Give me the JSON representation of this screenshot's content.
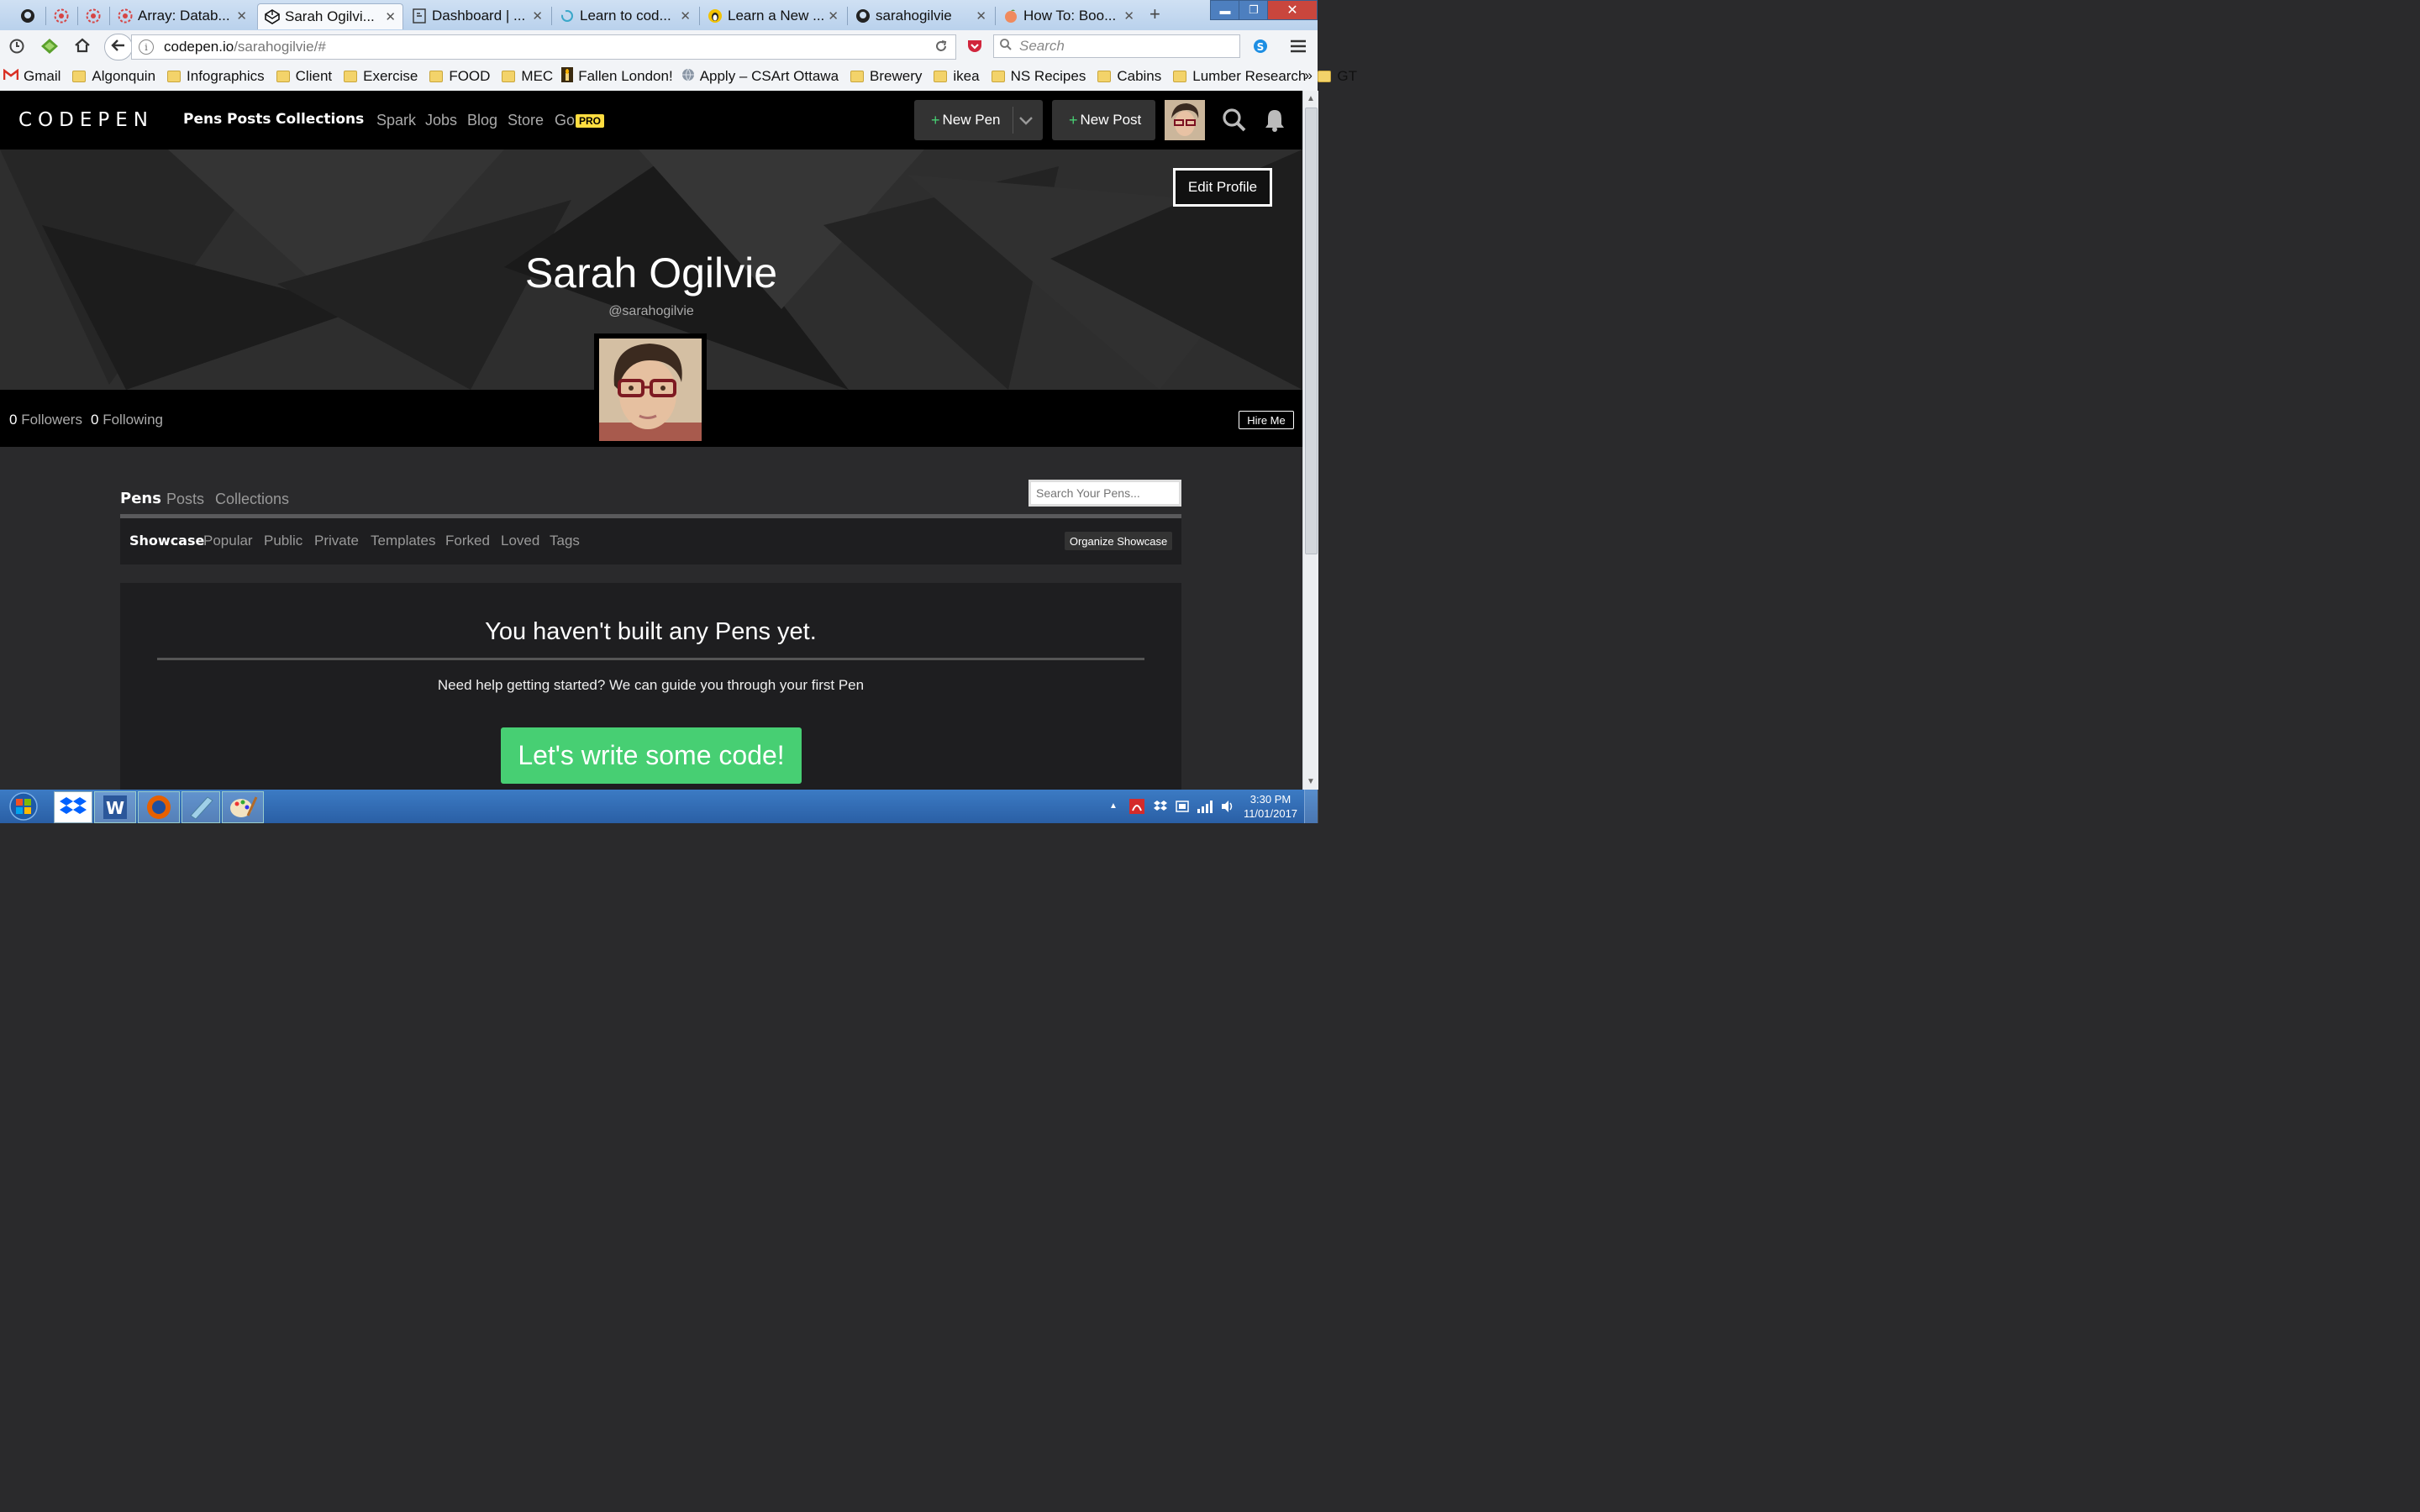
{
  "browser": {
    "tabs": [
      {
        "icon": "github-icon",
        "title": ""
      },
      {
        "icon": "pinwheel-icon",
        "title": ""
      },
      {
        "icon": "pinwheel-icon",
        "title": ""
      },
      {
        "icon": "pinwheel-icon",
        "title": "Array: Datab..."
      },
      {
        "icon": "codepen-icon",
        "title": "Sarah Ogilvi...",
        "active": true
      },
      {
        "icon": "page-icon",
        "title": "Dashboard | ..."
      },
      {
        "icon": "swirl-icon",
        "title": "Learn to cod..."
      },
      {
        "icon": "penguin-icon",
        "title": "Learn a New ..."
      },
      {
        "icon": "github-icon",
        "title": "sarahogilvie"
      },
      {
        "icon": "peach-icon",
        "title": "How To: Boo..."
      }
    ],
    "new_tab": "+",
    "url_domain": "codepen.io",
    "url_path": "/sarahogilvie/#",
    "search_placeholder": "Search",
    "bookmarks": [
      {
        "icon": "gmail-icon",
        "label": "Gmail"
      },
      {
        "icon": "folder-icon",
        "label": "Algonquin"
      },
      {
        "icon": "folder-icon",
        "label": "Infographics"
      },
      {
        "icon": "folder-icon",
        "label": "Client"
      },
      {
        "icon": "folder-icon",
        "label": "Exercise"
      },
      {
        "icon": "folder-icon",
        "label": "FOOD"
      },
      {
        "icon": "folder-icon",
        "label": "MEC"
      },
      {
        "icon": "candle-icon",
        "label": "Fallen London!"
      },
      {
        "icon": "globe-icon",
        "label": "Apply – CSArt Ottawa"
      },
      {
        "icon": "folder-icon",
        "label": "Brewery"
      },
      {
        "icon": "folder-icon",
        "label": "ikea"
      },
      {
        "icon": "folder-icon",
        "label": "NS Recipes"
      },
      {
        "icon": "folder-icon",
        "label": "Cabins"
      },
      {
        "icon": "folder-icon",
        "label": "Lumber Research"
      },
      {
        "icon": "folder-icon",
        "label": "GT"
      }
    ],
    "overflow": "»"
  },
  "codepen": {
    "logo": "CODEPEN",
    "nav_primary": [
      "Pens",
      "Posts",
      "Collections"
    ],
    "nav_secondary": [
      "Spark",
      "Jobs",
      "Blog",
      "Store",
      "Go"
    ],
    "pro_badge": "PRO",
    "new_pen": "New Pen",
    "new_post": "New Post",
    "plus": "+",
    "edit_profile": "Edit Profile",
    "profile_name": "Sarah Ogilvie",
    "handle": "@sarahogilvie",
    "followers_count": "0",
    "followers_label": "Followers",
    "following_count": "0",
    "following_label": "Following",
    "hire_me": "Hire Me",
    "content_tabs": [
      "Pens",
      "Posts",
      "Collections"
    ],
    "search_pens_placeholder": "Search Your Pens...",
    "filters": [
      "Showcase",
      "Popular",
      "Public",
      "Private",
      "Templates",
      "Forked",
      "Loved",
      "Tags"
    ],
    "organize": "Organize Showcase",
    "empty_heading": "You haven't built any Pens yet.",
    "empty_sub": "Need help getting started? We can guide you through your first Pen",
    "cta": "Let's write some code!",
    "colors": {
      "cta": "#47cf73",
      "pro": "#ffdd40",
      "plus": "#47cf73",
      "accent_red": "#d1253c"
    }
  },
  "taskbar": {
    "apps": [
      "start-orb-icon",
      "dropbox-icon",
      "word-icon",
      "firefox-icon",
      "notepad-icon",
      "paint-icon"
    ],
    "time": "3:30 PM",
    "date": "11/01/2017"
  }
}
